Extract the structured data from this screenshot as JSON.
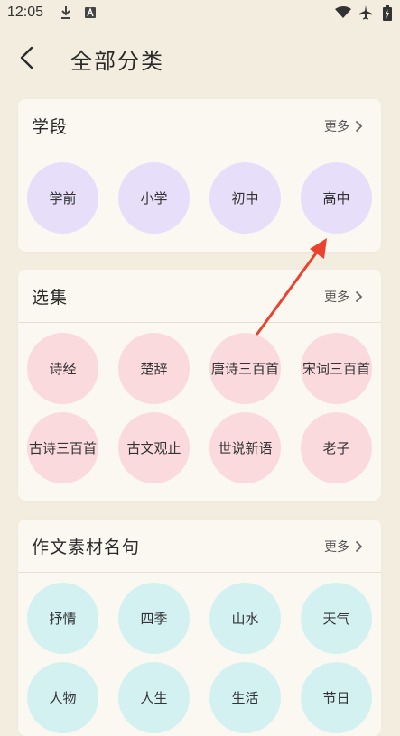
{
  "status": {
    "time": "12:05"
  },
  "header": {
    "title": "全部分类"
  },
  "more_label": "更多",
  "sections": [
    {
      "title": "学段",
      "items": [
        "学前",
        "小学",
        "初中",
        "高中"
      ]
    },
    {
      "title": "选集",
      "items": [
        "诗经",
        "楚辞",
        "唐诗三百首",
        "宋词三百首",
        "古诗三百首",
        "古文观止",
        "世说新语",
        "老子"
      ]
    },
    {
      "title": "作文素材名句",
      "items": [
        "抒情",
        "四季",
        "山水",
        "天气",
        "人物",
        "人生",
        "生活",
        "节日"
      ]
    }
  ],
  "colors": {
    "purple": "#e7defa",
    "pink": "#fadadd",
    "cyan": "#d4f1f1",
    "annotation_arrow": "#e8432f"
  }
}
